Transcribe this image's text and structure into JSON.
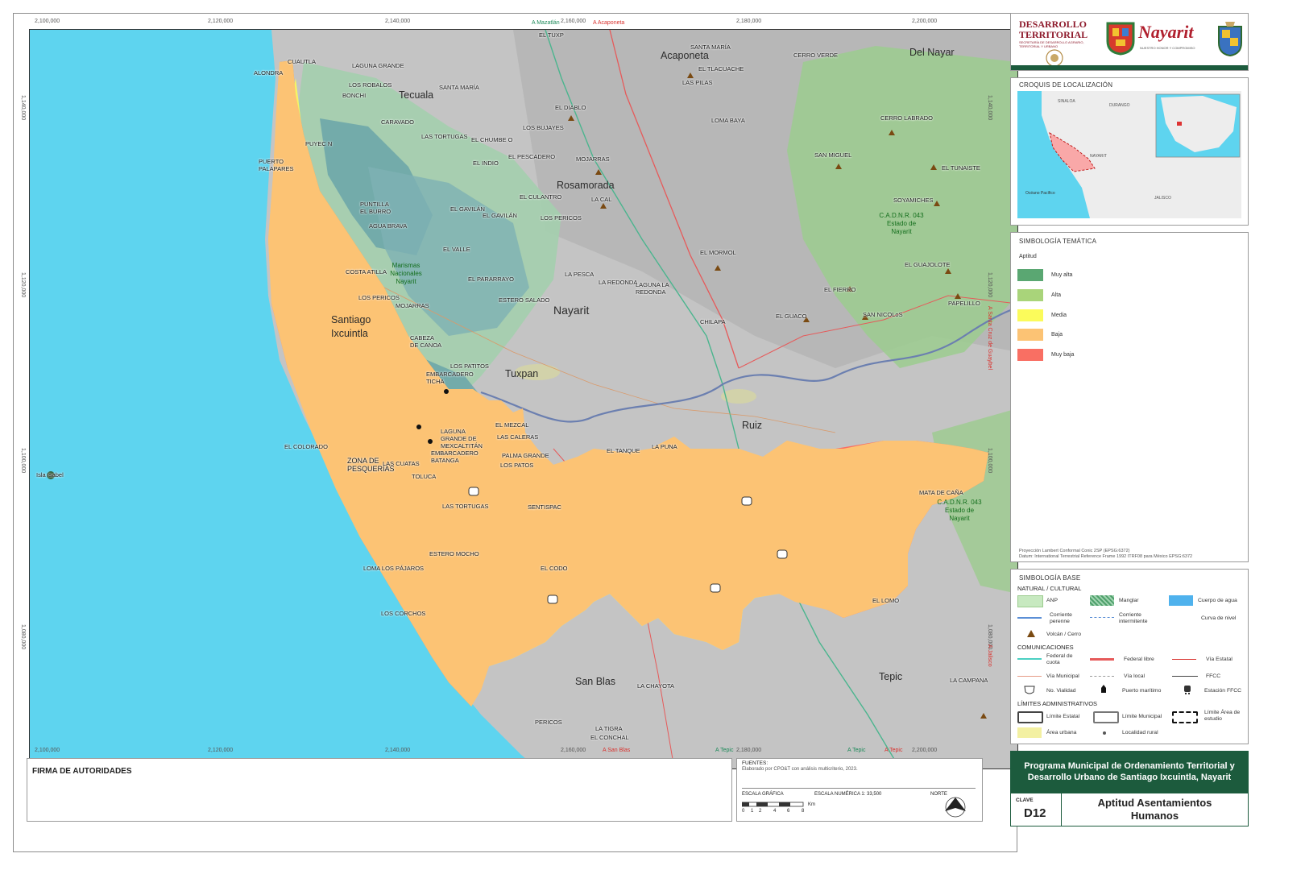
{
  "map": {
    "top_coords": [
      "2,100,000",
      "2,120,000",
      "2,140,000",
      "2,160,000",
      "2,180,000",
      "2,200,000"
    ],
    "bottom_coords": [
      "2,100,000",
      "2,120,000",
      "2,140,000",
      "2,160,000",
      "2,180,000",
      "2,200,000"
    ],
    "left_coords": [
      "1,140,000",
      "1,120,000",
      "1,100,000",
      "1,080,000"
    ],
    "right_coords": [
      "1,140,000",
      "1,120,000",
      "1,100,000",
      "1,080,000"
    ],
    "edge_labels": {
      "top_mazatlan": "A Mazatlán",
      "top_acaponeta": "A Acaponeta",
      "right_santa_cruz": "A Santa Cruz de Guaybel",
      "right_jalisco": "A Jalisco",
      "bottom_san_blas": "A San Blas",
      "bottom_tepic_a": "A Tepic",
      "bottom_tepic_b": "A Tepic",
      "bottom_tepic_c": "A Tepic"
    },
    "city_labels": {
      "acaponeta": "Acaponeta",
      "del_nayar": "Del Nayar",
      "tecuala": "Tecuala",
      "rosamorada": "Rosamorada",
      "nayarit": "Nayarit",
      "santiago": "Santiago",
      "ixcuintla": "Ixcuintla",
      "tuxpan": "Tuxpan",
      "ruiz": "Ruiz",
      "san_blas": "San Blas",
      "tepic": "Tepic"
    },
    "localities": {
      "cuautla": "CUAUTLA",
      "laguna_grande": "LAGUNA GRANDE",
      "el_tuxp": "EL TUXP",
      "santa_maria": "SANTA MARÍA",
      "cerro_verde": "CERRO VERDE",
      "el_tlacuache": "EL TLACUACHE",
      "las_pilas": "LAS PILAS",
      "alondra": "ALONDRA",
      "los_robalos": "LOS ROBALOS",
      "santa_maria_2": "SANTA MARÍA",
      "bonchi": "BONCHI",
      "el_diablo": "EL DIABLO",
      "cerro_labrado": "CERRO LABRADO",
      "loma_baya": "LOMA BAYA",
      "caravado": "CARAVADO",
      "los_bujayes": "LOS BUJAYES",
      "las_tortugas": "LAS TORTUGAS",
      "el_chumbe": "EL CHUMBE O",
      "puyec": "PUYEC N",
      "el_pescadero": "EL PESCADERO",
      "mojarras": "MOJARRAS",
      "san_miguel": "SAN MIGUEL",
      "el_tunaiste": "EL TUNAISTE",
      "puerto_palapares": "PUERTO PALAPARES",
      "el_indio": "EL INDIO",
      "el_culantro": "EL CULANTRO",
      "la_cal": "LA CAL",
      "soyamiches": "SOYAMICHES",
      "puntilla": "PUNTILLA EL BURRO",
      "el_gavilan": "EL GAVILÁN",
      "el_gavilan_n": "EL GAVILÁN",
      "los_pericos": "LOS PERICOS",
      "agua_brava": "AGUA BRAVA",
      "el_valle": "EL VALLE",
      "el_mormol": "EL MORMOL",
      "el_guajolote": "EL GUAJOLOTE",
      "la_pesca": "LA PESCA",
      "costa_atilla": "COSTA ATILLA",
      "el_pararrayo": "EL PARARRAYO",
      "la_redonda": "LA REDONDA",
      "laguna_redonda": "LAGUNA LA REDONDA",
      "el_fierro": "EL FIERRO",
      "papelillo": "PAPELILLO",
      "los_pericos_2": "LOS PERICOS",
      "estero_salado": "ESTERO SALADO",
      "san_nicolas": "SAN NICOLoS",
      "el_guaco": "EL GUACO",
      "chilapa": "CHILAPA",
      "mojarras_2": "MOJARRAS",
      "cabeza_canoa": "CABEZA DE CANOA",
      "los_patitos": "LOS PATITOS",
      "embarcadero_ticha": "EMBARCADERO TICHA",
      "el_mezcal": "EL MEZCAL",
      "laguna_mexcaltitan": "LAGUNA GRANDE DE MEXCALTITÁN",
      "las_caleras": "LAS CALERAS",
      "embarcadero_batanga": "EMBARCADERO BATANGA",
      "el_colorado": "EL COLORADO",
      "zona_pesquerias": "ZONA DE PESQUERÍAS",
      "las_cuatas": "LAS CUATAS",
      "palma_grande": "PALMA GRANDE",
      "los_patos": "LOS PATOS",
      "el_tanque": "EL TANQUE",
      "la_puna": "LA PUNA",
      "toluca": "TOLUCA",
      "mata_de_caña": "MATA DE CAÑA",
      "las_tortugas_2": "LAS TORTUGAS",
      "sentispac": "SENTISPAC",
      "estero_mocho": "ESTERO MOCHO",
      "loma_pajaros": "LOMA LOS PÁJAROS",
      "el_codo": "EL CODO",
      "los_corchos": "LOS CORCHOS",
      "la_chayota": "LA CHAYOTA",
      "la_campana": "LA CAMPANA",
      "pericos": "PERICOS",
      "la_tigra": "LA TIGRA",
      "el_conchal": "EL CONCHAL",
      "isla_isabel": "Isla Isabel",
      "el_lomo": "EL LOMO"
    },
    "green_labels": {
      "marismas": "Marismas Nacionales Nayarit",
      "cadnr_1": "C.A.D.N.R. 043 Estado de Nayarit",
      "cadnr_2": "C.A.D.N.R. 043 Estado de Nayarit"
    },
    "road_shields": [
      "15",
      "15",
      "72",
      "72",
      "15"
    ]
  },
  "header": {
    "desarrollo": "DESARROLLO",
    "territorial": "TERRITORIAL",
    "sedatu_sub": "SECRETARÍA DE DESARROLLO AGRARIO, TERRITORIAL Y URBANO",
    "nayarit_logo": "Nayarit",
    "nayarit_sub": "NUESTRO HONOR Y COMPROMISO"
  },
  "croquis": {
    "title": "CROQUIS DE LOCALIZACIÓN",
    "labels": {
      "sinaloa": "SINALOA",
      "durango": "DURANGO",
      "nayarit": "NAYARIT",
      "jalisco": "JALISCO",
      "oceano": "Océano Pacífico"
    }
  },
  "tematica": {
    "title": "SIMBOLOGÍA TEMÁTICA",
    "subtitle": "Aptitud",
    "items": [
      {
        "label": "Muy alta",
        "color": "#5aa772"
      },
      {
        "label": "Alta",
        "color": "#a9d47a"
      },
      {
        "label": "Media",
        "color": "#fbfb5b"
      },
      {
        "label": "Baja",
        "color": "#fcc374"
      },
      {
        "label": "Muy baja",
        "color": "#f96f63"
      }
    ],
    "projection_1": "Proyección Lambert Conformal Conic 2SP (EPSG:6372)",
    "projection_2": "Datum: International Terrestrial Reference Frame 1992 ITRF08 para México EPSG:6372"
  },
  "base": {
    "title": "SIMBOLOGÍA BASE",
    "sec_natural": "NATURAL / CULTURAL",
    "anp": "ANP",
    "manglar": "Manglar",
    "cuerpo_agua": "Cuerpo de agua",
    "corriente_perenne": "Corriente perenne",
    "corriente_intermitente": "Corriente intermitente",
    "curva_nivel": "Curva de nivel",
    "volcan": "Volcán / Cerro",
    "sec_comunicaciones": "COMUNICACIONES",
    "federal_cuota": "Federal de cuota",
    "federal_libre": "Federal libre",
    "via_estatal": "Vía Estatal",
    "via_municipal": "Vía Municipal",
    "via_local": "Vía local",
    "ffcc": "FFCC",
    "no_vialidad": "No. Vialidad",
    "puerto": "Puerto marítimo",
    "estacion": "Estación FFCC",
    "sec_limites": "LÍMITES ADMINISTRATIVOS",
    "limite_estatal": "Límite Estatal",
    "limite_municipal": "Límite Municipal",
    "limite_area": "Límite Área de estudio",
    "area_urbana": "Área urbana",
    "localidad_rural": "Localidad rural"
  },
  "firma": {
    "title": "FIRMA DE AUTORIDADES"
  },
  "fuentes": {
    "title": "FUENTES:",
    "text": "Elaborado por CPO&T con análisis multicriterio, 2023.",
    "escala_grafica": "ESCALA GRÁFICA",
    "escala_numerica": "ESCALA NUMÉRICA 1: 33,500",
    "norte": "NORTE",
    "km": "Km",
    "ticks": [
      "0",
      "1",
      "2",
      "4",
      "6",
      "8"
    ]
  },
  "programa": {
    "title": "Programa Municipal de Ordenamiento Territorial y Desarrollo Urbano de Santiago Ixcuintla, Nayarit",
    "clave_label": "CLAVE",
    "clave": "D12",
    "map_title": "Aptitud Asentamientos Humanos"
  },
  "colors": {
    "ocean": "#5ed4ef",
    "land": "#c3c3c3",
    "muy_alta": "#5aa772",
    "alta": "#a9d47a",
    "media": "#fbfb5b",
    "baja": "#fcc374",
    "muy_baja": "#f96f63",
    "dark_green": "#1f5f3a",
    "title_bg": "#1c5b3d"
  }
}
